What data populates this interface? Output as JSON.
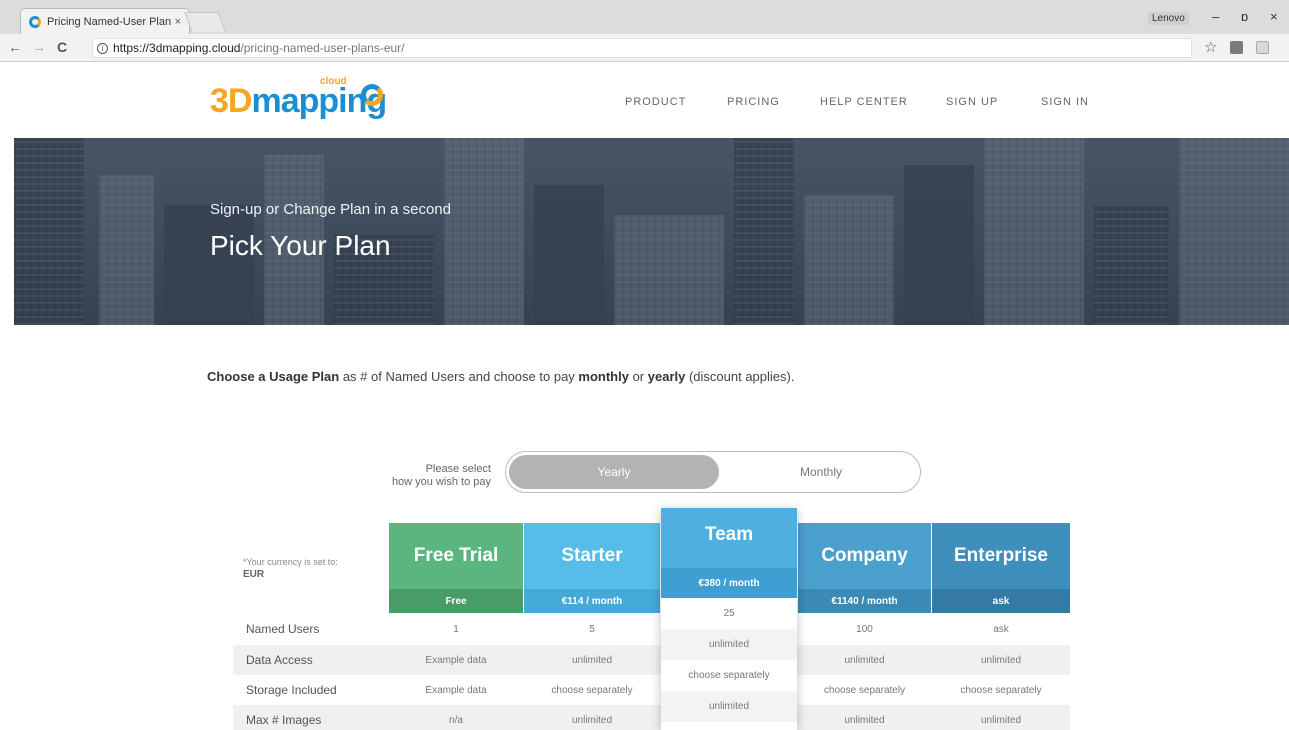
{
  "browser": {
    "tab_title": "Pricing Named-User Plan",
    "tab_close": "×",
    "profile": "Lenovo",
    "url_host": "https://3dmapping.cloud",
    "url_path": "/pricing-named-user-plans-eur/",
    "back": "←",
    "forward": "→",
    "reload": "C",
    "info": "i",
    "star": "☆",
    "minimize": "–",
    "maximize": "ɒ",
    "close": "×"
  },
  "site": {
    "logo_3d": "3D",
    "logo_mapping": "mapping",
    "logo_cloud": "cloud",
    "nav": [
      "PRODUCT",
      "PRICING",
      "HELP CENTER",
      "SIGN UP",
      "SIGN IN"
    ]
  },
  "hero": {
    "subtitle": "Sign-up or Change Plan in a second",
    "title": "Pick Your Plan"
  },
  "intro": {
    "part1": "Choose a Usage Plan",
    "part2": " as # of Named Users and choose to pay ",
    "part3": "monthly",
    "part4": " or ",
    "part5": "yearly",
    "part6": " (discount applies)."
  },
  "payment": {
    "label_line1": "Please select",
    "label_line2": "how you wish to pay",
    "yearly": "Yearly",
    "monthly": "Monthly",
    "selected": "Yearly"
  },
  "currency": {
    "note": "*Your currency is set to:",
    "code": "EUR"
  },
  "colors": {
    "free": "#5bb57e",
    "free_dark": "#479c68",
    "starter": "#56bdea",
    "starter_dark": "#45a9d8",
    "team": "#4fb0e0",
    "company": "#4b9fcc",
    "company_dark": "#3b8ab5",
    "enterprise": "#3f8fbd",
    "enterprise_dark": "#347aa2"
  },
  "plans": [
    {
      "name": "Free Trial",
      "price": "Free"
    },
    {
      "name": "Starter",
      "price": "€114 / month"
    },
    {
      "name": "Team",
      "price": "€380 / month"
    },
    {
      "name": "Company",
      "price": "€1140 / month"
    },
    {
      "name": "Enterprise",
      "price": "ask"
    }
  ],
  "rows": [
    {
      "label": "Named Users",
      "values": [
        "1",
        "5",
        "25",
        "100",
        "ask"
      ]
    },
    {
      "label": "Data Access",
      "values": [
        "Example data",
        "unlimited",
        "unlimited",
        "unlimited",
        "unlimited"
      ]
    },
    {
      "label": "Storage Included",
      "values": [
        "Example data",
        "choose separately",
        "choose separately",
        "choose separately",
        "choose separately"
      ]
    },
    {
      "label": "Max # Images",
      "values": [
        "n/a",
        "unlimited",
        "unlimited",
        "unlimited",
        "unlimited"
      ]
    }
  ]
}
